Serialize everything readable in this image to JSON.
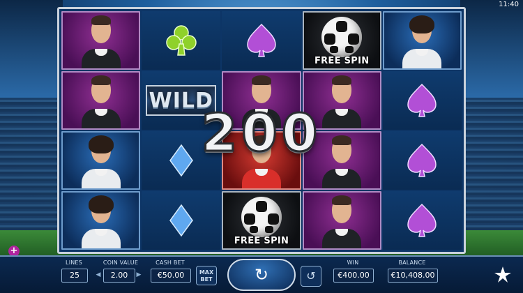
{
  "status_bar": {
    "time": "11:40"
  },
  "reels": [
    [
      {
        "type": "player",
        "variant": "mohawk",
        "bg": "purple"
      },
      {
        "type": "player",
        "variant": "mohawk",
        "bg": "purple"
      },
      {
        "type": "player",
        "variant": "long",
        "bg": "blue"
      },
      {
        "type": "player",
        "variant": "long",
        "bg": "blue"
      }
    ],
    [
      {
        "type": "suit",
        "suit": "club",
        "color": "green"
      },
      {
        "type": "wild",
        "label": "WILD"
      },
      {
        "type": "suit",
        "suit": "diamond",
        "color": "blue"
      },
      {
        "type": "suit",
        "suit": "diamond",
        "color": "blue"
      }
    ],
    [
      {
        "type": "suit",
        "suit": "spade",
        "color": "purple"
      },
      {
        "type": "player",
        "variant": "mohawk",
        "bg": "purple"
      },
      {
        "type": "player",
        "variant": "redshirt",
        "bg": "red"
      },
      {
        "type": "scatter",
        "label": "FREE SPIN"
      }
    ],
    [
      {
        "type": "scatter",
        "label": "FREE SPIN"
      },
      {
        "type": "player",
        "variant": "mohawk",
        "bg": "purple"
      },
      {
        "type": "player",
        "variant": "mohawk",
        "bg": "purple"
      },
      {
        "type": "player",
        "variant": "mohawk",
        "bg": "purple"
      }
    ],
    [
      {
        "type": "player",
        "variant": "long",
        "bg": "blue"
      },
      {
        "type": "suit",
        "suit": "spade",
        "color": "purple"
      },
      {
        "type": "suit",
        "suit": "spade",
        "color": "purple"
      },
      {
        "type": "suit",
        "suit": "spade",
        "color": "purple"
      }
    ]
  ],
  "win_overlay": {
    "amount": "200"
  },
  "controls": {
    "lines": {
      "label": "LINES",
      "value": "25"
    },
    "coin_value": {
      "label": "COIN VALUE",
      "value": "2.00"
    },
    "cash_bet": {
      "label": "CASH BET",
      "value": "€50.00"
    },
    "max_bet": {
      "label_top": "MAX",
      "label_bottom": "BET"
    },
    "win": {
      "label": "WIN",
      "value": "€400.00"
    },
    "balance": {
      "label": "BALANCE",
      "value": "€10,408.00"
    },
    "spin_icon": "refresh-icon",
    "autoplay_icon": "autoplay-icon",
    "menu_icon": "plus-icon"
  },
  "colors": {
    "purple_tile": "#8f2f92",
    "blue_tile": "#2a6cb6",
    "red_tile": "#d63b32",
    "accent_magenta": "#b0239e",
    "suit_green": "#8fd12a",
    "suit_blue": "#5fa8f0",
    "suit_purple": "#b24fd6"
  }
}
